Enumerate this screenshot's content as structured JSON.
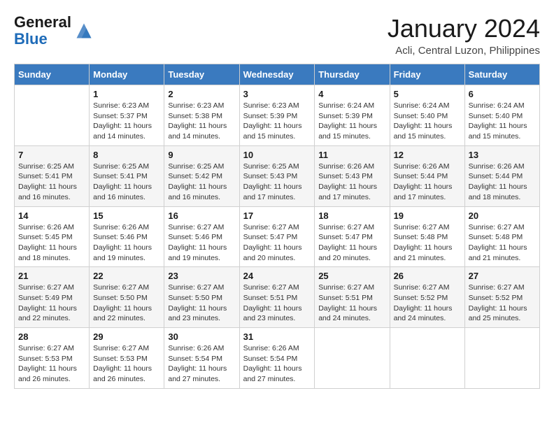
{
  "header": {
    "logo_general": "General",
    "logo_blue": "Blue",
    "month_title": "January 2024",
    "location": "Acli, Central Luzon, Philippines"
  },
  "days_of_week": [
    "Sunday",
    "Monday",
    "Tuesday",
    "Wednesday",
    "Thursday",
    "Friday",
    "Saturday"
  ],
  "weeks": [
    [
      {
        "day": "",
        "info": ""
      },
      {
        "day": "1",
        "info": "Sunrise: 6:23 AM\nSunset: 5:37 PM\nDaylight: 11 hours\nand 14 minutes."
      },
      {
        "day": "2",
        "info": "Sunrise: 6:23 AM\nSunset: 5:38 PM\nDaylight: 11 hours\nand 14 minutes."
      },
      {
        "day": "3",
        "info": "Sunrise: 6:23 AM\nSunset: 5:39 PM\nDaylight: 11 hours\nand 15 minutes."
      },
      {
        "day": "4",
        "info": "Sunrise: 6:24 AM\nSunset: 5:39 PM\nDaylight: 11 hours\nand 15 minutes."
      },
      {
        "day": "5",
        "info": "Sunrise: 6:24 AM\nSunset: 5:40 PM\nDaylight: 11 hours\nand 15 minutes."
      },
      {
        "day": "6",
        "info": "Sunrise: 6:24 AM\nSunset: 5:40 PM\nDaylight: 11 hours\nand 15 minutes."
      }
    ],
    [
      {
        "day": "7",
        "info": "Sunrise: 6:25 AM\nSunset: 5:41 PM\nDaylight: 11 hours\nand 16 minutes."
      },
      {
        "day": "8",
        "info": "Sunrise: 6:25 AM\nSunset: 5:41 PM\nDaylight: 11 hours\nand 16 minutes."
      },
      {
        "day": "9",
        "info": "Sunrise: 6:25 AM\nSunset: 5:42 PM\nDaylight: 11 hours\nand 16 minutes."
      },
      {
        "day": "10",
        "info": "Sunrise: 6:25 AM\nSunset: 5:43 PM\nDaylight: 11 hours\nand 17 minutes."
      },
      {
        "day": "11",
        "info": "Sunrise: 6:26 AM\nSunset: 5:43 PM\nDaylight: 11 hours\nand 17 minutes."
      },
      {
        "day": "12",
        "info": "Sunrise: 6:26 AM\nSunset: 5:44 PM\nDaylight: 11 hours\nand 17 minutes."
      },
      {
        "day": "13",
        "info": "Sunrise: 6:26 AM\nSunset: 5:44 PM\nDaylight: 11 hours\nand 18 minutes."
      }
    ],
    [
      {
        "day": "14",
        "info": "Sunrise: 6:26 AM\nSunset: 5:45 PM\nDaylight: 11 hours\nand 18 minutes."
      },
      {
        "day": "15",
        "info": "Sunrise: 6:26 AM\nSunset: 5:46 PM\nDaylight: 11 hours\nand 19 minutes."
      },
      {
        "day": "16",
        "info": "Sunrise: 6:27 AM\nSunset: 5:46 PM\nDaylight: 11 hours\nand 19 minutes."
      },
      {
        "day": "17",
        "info": "Sunrise: 6:27 AM\nSunset: 5:47 PM\nDaylight: 11 hours\nand 20 minutes."
      },
      {
        "day": "18",
        "info": "Sunrise: 6:27 AM\nSunset: 5:47 PM\nDaylight: 11 hours\nand 20 minutes."
      },
      {
        "day": "19",
        "info": "Sunrise: 6:27 AM\nSunset: 5:48 PM\nDaylight: 11 hours\nand 21 minutes."
      },
      {
        "day": "20",
        "info": "Sunrise: 6:27 AM\nSunset: 5:48 PM\nDaylight: 11 hours\nand 21 minutes."
      }
    ],
    [
      {
        "day": "21",
        "info": "Sunrise: 6:27 AM\nSunset: 5:49 PM\nDaylight: 11 hours\nand 22 minutes."
      },
      {
        "day": "22",
        "info": "Sunrise: 6:27 AM\nSunset: 5:50 PM\nDaylight: 11 hours\nand 22 minutes."
      },
      {
        "day": "23",
        "info": "Sunrise: 6:27 AM\nSunset: 5:50 PM\nDaylight: 11 hours\nand 23 minutes."
      },
      {
        "day": "24",
        "info": "Sunrise: 6:27 AM\nSunset: 5:51 PM\nDaylight: 11 hours\nand 23 minutes."
      },
      {
        "day": "25",
        "info": "Sunrise: 6:27 AM\nSunset: 5:51 PM\nDaylight: 11 hours\nand 24 minutes."
      },
      {
        "day": "26",
        "info": "Sunrise: 6:27 AM\nSunset: 5:52 PM\nDaylight: 11 hours\nand 24 minutes."
      },
      {
        "day": "27",
        "info": "Sunrise: 6:27 AM\nSunset: 5:52 PM\nDaylight: 11 hours\nand 25 minutes."
      }
    ],
    [
      {
        "day": "28",
        "info": "Sunrise: 6:27 AM\nSunset: 5:53 PM\nDaylight: 11 hours\nand 26 minutes."
      },
      {
        "day": "29",
        "info": "Sunrise: 6:27 AM\nSunset: 5:53 PM\nDaylight: 11 hours\nand 26 minutes."
      },
      {
        "day": "30",
        "info": "Sunrise: 6:26 AM\nSunset: 5:54 PM\nDaylight: 11 hours\nand 27 minutes."
      },
      {
        "day": "31",
        "info": "Sunrise: 6:26 AM\nSunset: 5:54 PM\nDaylight: 11 hours\nand 27 minutes."
      },
      {
        "day": "",
        "info": ""
      },
      {
        "day": "",
        "info": ""
      },
      {
        "day": "",
        "info": ""
      }
    ]
  ]
}
